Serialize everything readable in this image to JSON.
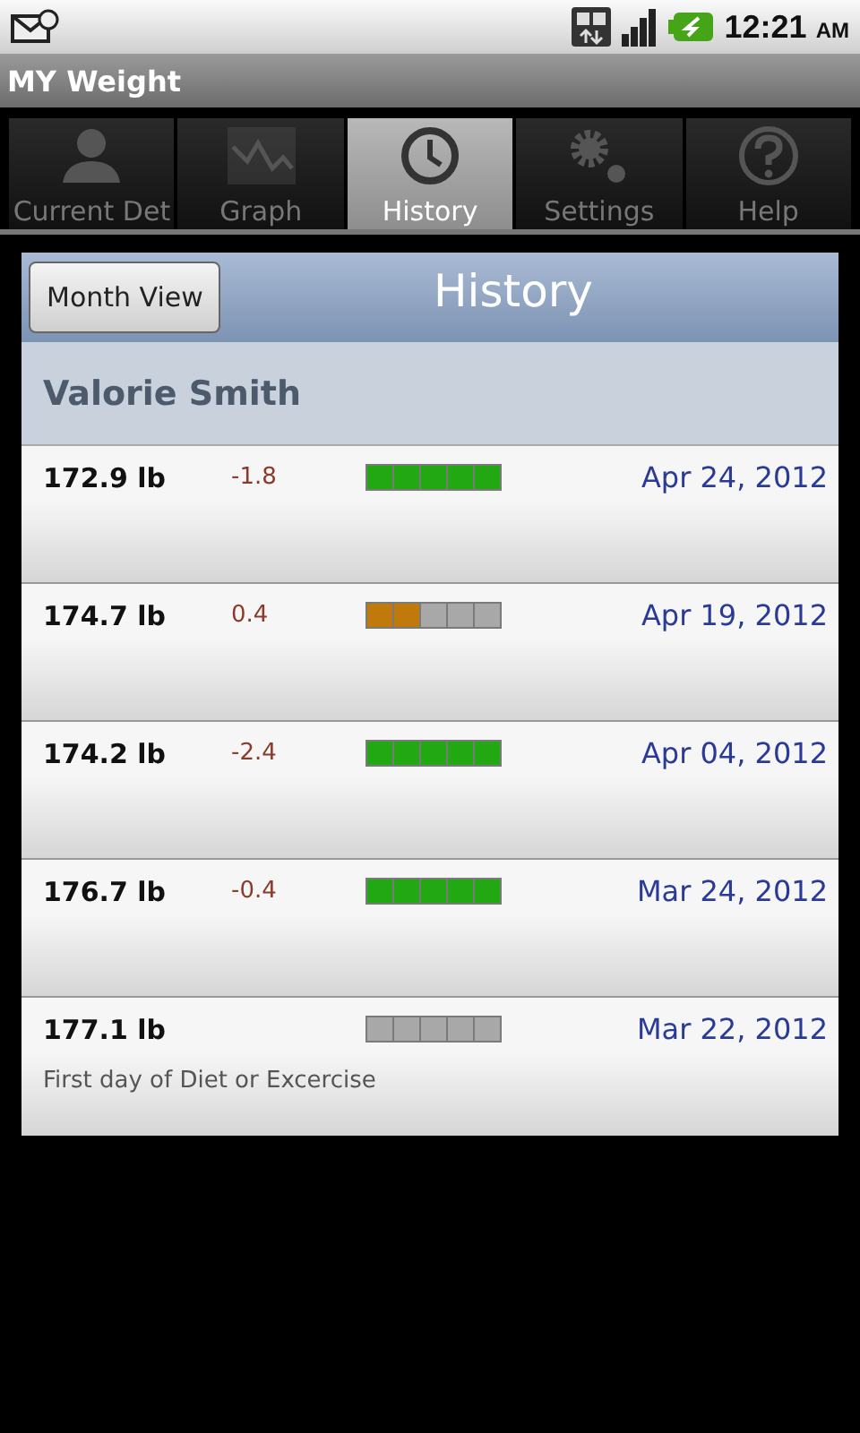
{
  "status_bar": {
    "time": "12:21",
    "meridiem": "AM"
  },
  "app_bar": {
    "title": "MY Weight"
  },
  "tabs": [
    {
      "label": "Current Det",
      "selected": false,
      "kind": "person"
    },
    {
      "label": "Graph",
      "selected": false,
      "kind": "graph"
    },
    {
      "label": "History",
      "selected": true,
      "kind": "clock"
    },
    {
      "label": "Settings",
      "selected": false,
      "kind": "gears"
    },
    {
      "label": "Help",
      "selected": false,
      "kind": "help"
    }
  ],
  "header": {
    "button": "Month View",
    "title": "History"
  },
  "user_name": "Valorie Smith",
  "entries": [
    {
      "weight": "172.9 lb",
      "change": "-1.8",
      "stars": 5,
      "color": "#22a812",
      "date": "Apr 24, 2012"
    },
    {
      "weight": "174.7 lb",
      "change": "0.4",
      "stars": 2,
      "color": "#c07a0c",
      "date": "Apr 19, 2012"
    },
    {
      "weight": "174.2 lb",
      "change": "-2.4",
      "stars": 5,
      "color": "#22a812",
      "date": "Apr 04, 2012"
    },
    {
      "weight": "176.7 lb",
      "change": "-0.4",
      "stars": 5,
      "color": "#22a812",
      "date": "Mar 24, 2012"
    },
    {
      "weight": "177.1 lb",
      "stars": 0,
      "date": "Mar 22, 2012",
      "note": "First day of Diet or Excercise"
    }
  ]
}
